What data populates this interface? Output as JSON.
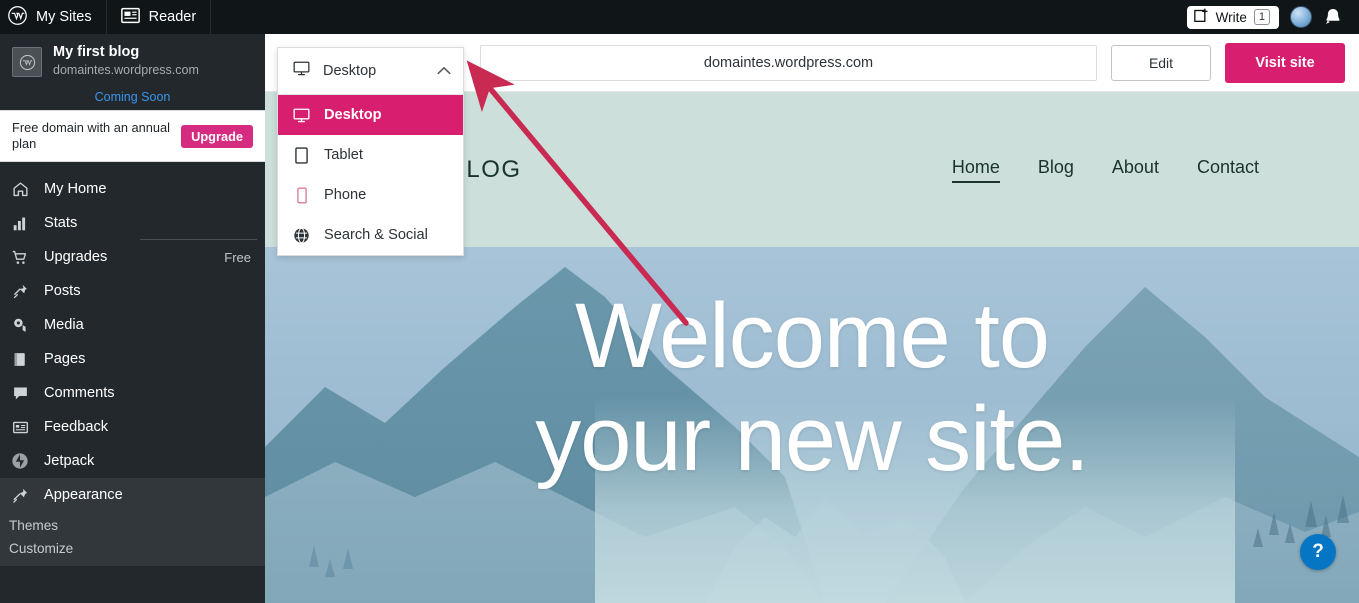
{
  "masterbar": {
    "my_sites": "My Sites",
    "reader": "Reader",
    "write": "Write",
    "write_badge": "1",
    "icons": {
      "wordpress": "wordpress-logo-icon",
      "reader": "reader-icon",
      "write": "write-pencil-icon",
      "avatar": "avatar",
      "bell": "notifications-bell-icon"
    },
    "colors": {
      "bg": "#101517"
    }
  },
  "sidebar": {
    "site": {
      "title": "My first blog",
      "url": "domaintes.wordpress.com",
      "status_link": "Coming Soon"
    },
    "upsell": {
      "text": "Free domain with an annual plan",
      "button": "Upgrade"
    },
    "items": [
      {
        "label": "My Home",
        "icon": "home-icon",
        "aside": ""
      },
      {
        "label": "Stats",
        "icon": "stats-bar-icon",
        "aside": ""
      },
      {
        "label": "Upgrades",
        "icon": "cart-icon",
        "aside": "Free"
      },
      {
        "label": "Posts",
        "icon": "pushpin-icon",
        "aside": ""
      },
      {
        "label": "Media",
        "icon": "media-icon",
        "aside": ""
      },
      {
        "label": "Pages",
        "icon": "pages-book-icon",
        "aside": ""
      },
      {
        "label": "Comments",
        "icon": "comment-icon",
        "aside": ""
      },
      {
        "label": "Feedback",
        "icon": "feedback-icon",
        "aside": ""
      },
      {
        "label": "Jetpack",
        "icon": "jetpack-icon",
        "aside": ""
      },
      {
        "label": "Appearance",
        "icon": "appearance-brush-icon",
        "aside": ""
      }
    ],
    "appearance_subitems": [
      {
        "label": "Themes"
      },
      {
        "label": "Customize"
      }
    ],
    "colors": {
      "bg": "#23282d",
      "expanded_bg": "#32373c",
      "link": "#3895ec"
    }
  },
  "preview_toolbar": {
    "url": "domaintes.wordpress.com",
    "edit": "Edit",
    "visit": "Visit site",
    "colors": {
      "visit_bg": "#d81e6f"
    }
  },
  "device_dropdown": {
    "header_label": "Desktop",
    "header_icon": "monitor-icon",
    "chevron": "chevron-up-icon",
    "options": [
      {
        "label": "Desktop",
        "icon": "monitor-icon",
        "selected": true
      },
      {
        "label": "Tablet",
        "icon": "tablet-icon",
        "selected": false
      },
      {
        "label": "Phone",
        "icon": "phone-icon",
        "selected": false
      },
      {
        "label": "Search & Social",
        "icon": "globe-icon",
        "selected": false
      }
    ],
    "colors": {
      "selected_bg": "#d81e6f"
    }
  },
  "site_preview": {
    "brand": "T BLOG",
    "nav": [
      {
        "label": "Home",
        "active": true
      },
      {
        "label": "Blog",
        "active": false
      },
      {
        "label": "About",
        "active": false
      },
      {
        "label": "Contact",
        "active": false
      }
    ],
    "hero_line1": "Welcome to",
    "hero_line2": "your new site.",
    "colors": {
      "header_bg": "#cddfda",
      "text": "#18342c"
    }
  },
  "help": {
    "label": "?",
    "icon": "help-question-icon",
    "color": "#0675c4"
  },
  "annotation": {
    "type": "arrow",
    "color": "#c92a52",
    "points_to": "device-dropdown"
  }
}
